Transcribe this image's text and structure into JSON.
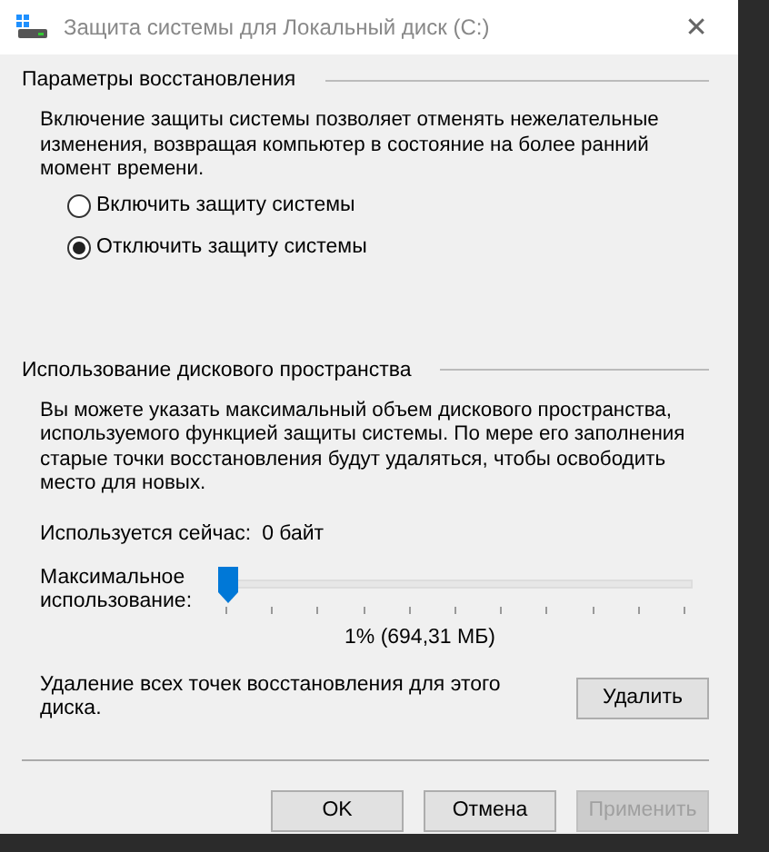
{
  "window": {
    "title": "Защита системы для Локальный диск (C:)",
    "close": "✕"
  },
  "restore_settings": {
    "heading": "Параметры восстановления",
    "description": "Включение защиты системы позволяет отменять нежелательные изменения, возвращая компьютер в состояние на более ранний момент времени.",
    "options": [
      {
        "label": "Включить защиту системы",
        "selected": false
      },
      {
        "label": "Отключить защиту системы",
        "selected": true
      }
    ]
  },
  "disk_usage": {
    "heading": "Использование дискового пространства",
    "description": "Вы можете указать максимальный объем дискового пространства, используемого функцией защиты системы. По мере его заполнения старые точки восстановления будут удаляться, чтобы освободить место для новых.",
    "current_label": "Используется сейчас:",
    "current_value": "0 байт",
    "max_label": "Максимальное использование:",
    "slider": {
      "level": 0.01
    },
    "reading": "1% (694,31 МБ)",
    "delete_text": "Удаление всех точек восстановления для этого диска.",
    "delete_button": "Удалить"
  },
  "buttons": [
    {
      "label": "OK",
      "disabled": false
    },
    {
      "label": "Отмена",
      "disabled": false
    },
    {
      "label": "Применить",
      "disabled": true
    }
  ]
}
